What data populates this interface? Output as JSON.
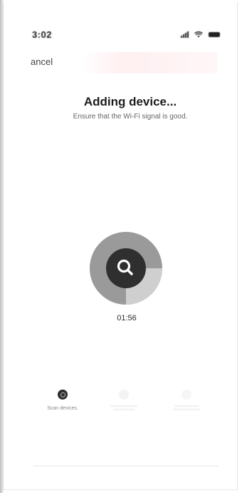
{
  "status_bar": {
    "time": "3:02"
  },
  "nav": {
    "cancel_label": "ancel"
  },
  "main": {
    "title": "Adding device...",
    "subtitle": "Ensure that the Wi-Fi signal is good.",
    "timer": "01:56",
    "progress": 0.25
  },
  "steps": [
    {
      "label": "Scan devices.",
      "active": true
    },
    {
      "label": "",
      "active": false
    },
    {
      "label": "",
      "active": false
    }
  ],
  "colors": {
    "ring": "#9a9a9a",
    "ring_light": "#cfcfcf",
    "core": "#2f2f2f",
    "accent_tint": "#ffeef0"
  }
}
